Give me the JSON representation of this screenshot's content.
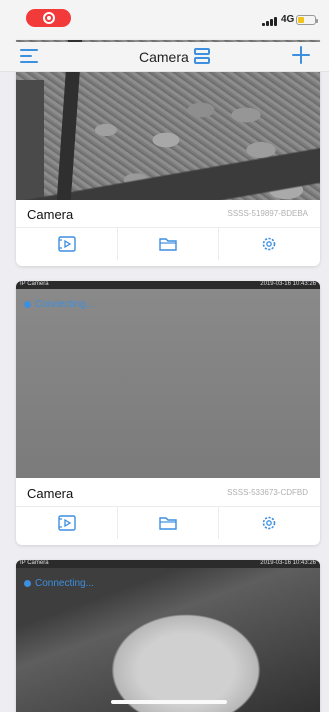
{
  "status_bar": {
    "network": "4G",
    "recording_icon": "screen-record-icon"
  },
  "navbar": {
    "title": "Camera",
    "menu_icon": "menu-icon",
    "layout_icon": "layout-toggle-icon",
    "add_icon": "add-icon"
  },
  "cameras": [
    {
      "name": "Camera",
      "id": "SSSS-519897-BDEBA",
      "status": "",
      "osd_left": "",
      "osd_right": ""
    },
    {
      "name": "Camera",
      "id": "SSSS-533673-CDFBD",
      "status": "Connecting...",
      "osd_left": "IP Camera",
      "osd_right": "2019-03-16 10:43:26"
    },
    {
      "name": "",
      "id": "",
      "status": "Connecting...",
      "osd_left": "IP Camera",
      "osd_right": "2019-03-16 10:43:26"
    }
  ],
  "actions": [
    "playback-icon",
    "folder-icon",
    "settings-icon"
  ],
  "colors": {
    "accent": "#3d8fe0",
    "record": "#f23a3a",
    "battery": "#f0c419"
  }
}
